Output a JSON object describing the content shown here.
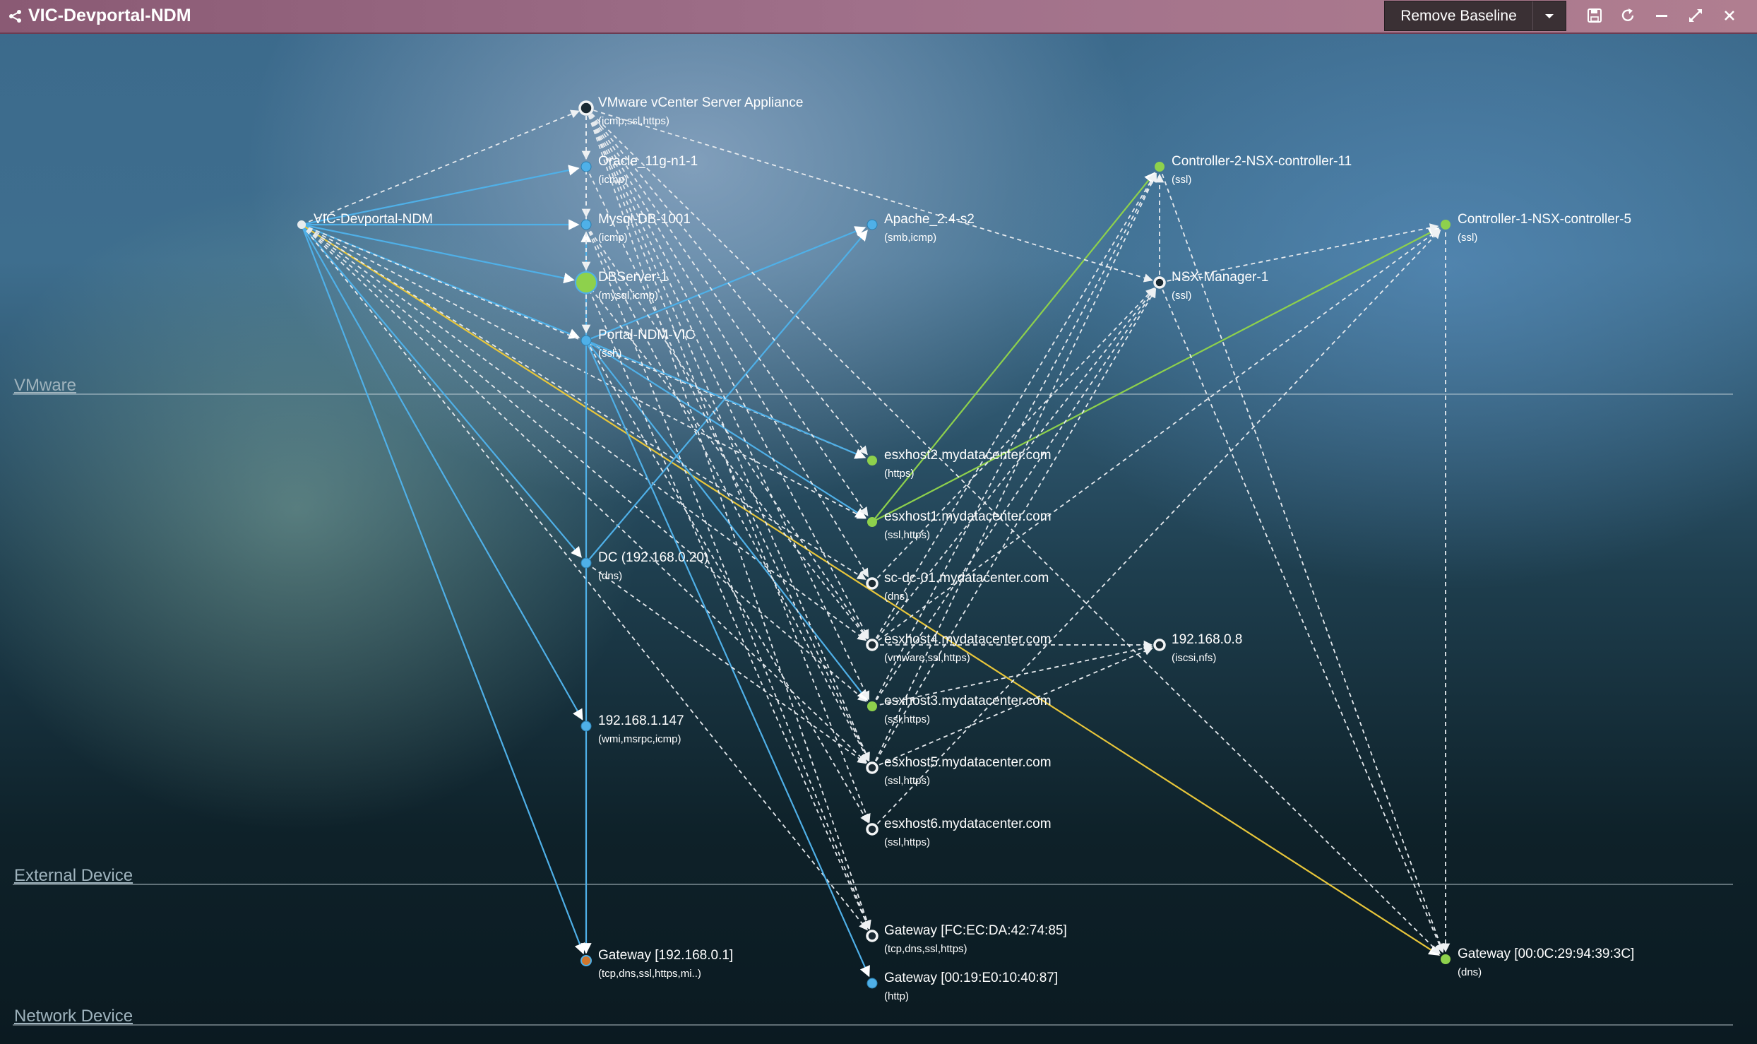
{
  "window": {
    "title": "VIC-Devportal-NDM",
    "remove_baseline_label": "Remove Baseline",
    "toolbar_icons": [
      "dropdown-caret-icon",
      "save-icon",
      "refresh-icon",
      "minimize-icon",
      "expand-icon",
      "close-icon"
    ]
  },
  "bands": [
    {
      "id": "vmware",
      "label": "VMware"
    },
    {
      "id": "external",
      "label": "External Device"
    },
    {
      "id": "network",
      "label": "Network Device"
    }
  ],
  "colors": {
    "blue_link": "#4fb0e8",
    "green_link": "#8ed14c",
    "yellow_link": "#e8c63a",
    "dashed_link": "#e6eaee",
    "green_node": "#8ed14c",
    "blue_node": "#4fb0e8",
    "orange_node": "#d0762c"
  },
  "nodes": [
    {
      "id": "vic",
      "label": "VIC-Devportal-NDM",
      "sub": "",
      "style": "white-dot"
    },
    {
      "id": "vcenter",
      "label": "VMware vCenter Server Appliance",
      "sub": "(icmp,ssl,https)",
      "style": "ring"
    },
    {
      "id": "oracle",
      "label": "Oracle_11g-n1-1",
      "sub": "(icmp)",
      "style": "blue"
    },
    {
      "id": "mysql",
      "label": "Mysql-DB-1001",
      "sub": "(icmp)",
      "style": "blue"
    },
    {
      "id": "dbserver",
      "label": "DBServer-1",
      "sub": "(mysql,icmp)",
      "style": "green-big"
    },
    {
      "id": "portal",
      "label": "Portal-NDM-VIC",
      "sub": "(ssh)",
      "style": "blue"
    },
    {
      "id": "apache",
      "label": "Apache_2.4-s2",
      "sub": "(smb,icmp)",
      "style": "blue"
    },
    {
      "id": "ctrl2",
      "label": "Controller-2-NSX-controller-11",
      "sub": "(ssl)",
      "style": "green"
    },
    {
      "id": "ctrl1",
      "label": "Controller-1-NSX-controller-5",
      "sub": "(ssl)",
      "style": "green"
    },
    {
      "id": "nsxmgr",
      "label": "NSX-Manager-1",
      "sub": "(ssl)",
      "style": "ring"
    },
    {
      "id": "esx2",
      "label": "esxhost2.mydatacenter.com",
      "sub": "(https)",
      "style": "green"
    },
    {
      "id": "esx1",
      "label": "esxhost1.mydatacenter.com",
      "sub": "(ssl,https)",
      "style": "green"
    },
    {
      "id": "scdc",
      "label": "sc-dc-01.mydatacenter.com",
      "sub": "(dns)",
      "style": "ring"
    },
    {
      "id": "esx4",
      "label": "esxhost4.mydatacenter.com",
      "sub": "(vmware,ssl,https)",
      "style": "ring"
    },
    {
      "id": "ip08",
      "label": "192.168.0.8",
      "sub": "(iscsi,nfs)",
      "style": "ring"
    },
    {
      "id": "esx3",
      "label": "esxhost3.mydatacenter.com",
      "sub": "(ssl,https)",
      "style": "green"
    },
    {
      "id": "esx5",
      "label": "esxhost5.mydatacenter.com",
      "sub": "(ssl,https)",
      "style": "ring"
    },
    {
      "id": "esx6",
      "label": "esxhost6.mydatacenter.com",
      "sub": "(ssl,https)",
      "style": "ring"
    },
    {
      "id": "dc",
      "label": "DC (192.168.0.20)",
      "sub": "(dns)",
      "style": "blue"
    },
    {
      "id": "ip147",
      "label": "192.168.1.147",
      "sub": "(wmi,msrpc,icmp)",
      "style": "blue"
    },
    {
      "id": "gw01",
      "label": "Gateway [192.168.0.1]",
      "sub": "(tcp,dns,ssl,https,mi..)",
      "style": "orange"
    },
    {
      "id": "gwfc",
      "label": "Gateway [FC:EC:DA:42:74:85]",
      "sub": "(tcp,dns,ssl,https)",
      "style": "ring"
    },
    {
      "id": "gw019",
      "label": "Gateway [00:19:E0:10:40:87]",
      "sub": "(http)",
      "style": "blue"
    },
    {
      "id": "gw00c",
      "label": "Gateway [00:0C:29:94:39:3C]",
      "sub": "(dns)",
      "style": "green"
    }
  ],
  "links": [
    {
      "from": "vic",
      "to": "oracle",
      "type": "blue"
    },
    {
      "from": "vic",
      "to": "mysql",
      "type": "blue"
    },
    {
      "from": "vic",
      "to": "dbserver",
      "type": "blue"
    },
    {
      "from": "vic",
      "to": "portal",
      "type": "blue"
    },
    {
      "from": "vic",
      "to": "dc",
      "type": "blue"
    },
    {
      "from": "vic",
      "to": "ip147",
      "type": "blue"
    },
    {
      "from": "vic",
      "to": "gw01",
      "type": "blue"
    },
    {
      "from": "vic",
      "to": "gw00c",
      "type": "yellow"
    },
    {
      "from": "vic",
      "to": "vcenter",
      "type": "dashed"
    },
    {
      "from": "vic",
      "to": "esx2",
      "type": "dashed"
    },
    {
      "from": "vic",
      "to": "esx1",
      "type": "dashed"
    },
    {
      "from": "vic",
      "to": "scdc",
      "type": "dashed"
    },
    {
      "from": "vic",
      "to": "esx4",
      "type": "dashed"
    },
    {
      "from": "vic",
      "to": "esx3",
      "type": "dashed"
    },
    {
      "from": "vic",
      "to": "esx5",
      "type": "dashed"
    },
    {
      "from": "vic",
      "to": "gwfc",
      "type": "dashed"
    },
    {
      "from": "portal",
      "to": "esx2",
      "type": "blue"
    },
    {
      "from": "portal",
      "to": "esx1",
      "type": "blue"
    },
    {
      "from": "portal",
      "to": "apache",
      "type": "blue"
    },
    {
      "from": "portal",
      "to": "esx3",
      "type": "blue"
    },
    {
      "from": "dc",
      "to": "apache",
      "type": "blue"
    },
    {
      "from": "portal",
      "to": "gw019",
      "type": "blue"
    },
    {
      "from": "portal",
      "to": "mysql",
      "type": "blue"
    },
    {
      "from": "portal",
      "to": "gw01",
      "type": "blue"
    },
    {
      "from": "esx1",
      "to": "ctrl2",
      "type": "green"
    },
    {
      "from": "esx1",
      "to": "ctrl1",
      "type": "green"
    },
    {
      "from": "vcenter",
      "to": "nsxmgr",
      "type": "dashed"
    },
    {
      "from": "vcenter",
      "to": "esx2",
      "type": "dashed"
    },
    {
      "from": "vcenter",
      "to": "esx1",
      "type": "dashed"
    },
    {
      "from": "vcenter",
      "to": "scdc",
      "type": "dashed"
    },
    {
      "from": "vcenter",
      "to": "esx4",
      "type": "dashed"
    },
    {
      "from": "vcenter",
      "to": "esx3",
      "type": "dashed"
    },
    {
      "from": "vcenter",
      "to": "esx5",
      "type": "dashed"
    },
    {
      "from": "vcenter",
      "to": "esx6",
      "type": "dashed"
    },
    {
      "from": "vcenter",
      "to": "gwfc",
      "type": "dashed"
    },
    {
      "from": "vcenter",
      "to": "gw00c",
      "type": "dashed"
    },
    {
      "from": "vcenter",
      "to": "oracle",
      "type": "dashed"
    },
    {
      "from": "vcenter",
      "to": "mysql",
      "type": "dashed"
    },
    {
      "from": "vcenter",
      "to": "dbserver",
      "type": "dashed"
    },
    {
      "from": "vcenter",
      "to": "portal",
      "type": "dashed"
    },
    {
      "from": "nsxmgr",
      "to": "ctrl2",
      "type": "dashed"
    },
    {
      "from": "nsxmgr",
      "to": "ctrl1",
      "type": "dashed"
    },
    {
      "from": "esx4",
      "to": "ctrl2",
      "type": "dashed"
    },
    {
      "from": "esx4",
      "to": "nsxmgr",
      "type": "dashed"
    },
    {
      "from": "esx4",
      "to": "ip08",
      "type": "dashed"
    },
    {
      "from": "esx3",
      "to": "ip08",
      "type": "dashed"
    },
    {
      "from": "esx5",
      "to": "ip08",
      "type": "dashed"
    },
    {
      "from": "esx5",
      "to": "ctrl2",
      "type": "dashed"
    },
    {
      "from": "esx5",
      "to": "nsxmgr",
      "type": "dashed"
    },
    {
      "from": "esx3",
      "to": "ctrl2",
      "type": "dashed"
    },
    {
      "from": "esx3",
      "to": "nsxmgr",
      "type": "dashed"
    },
    {
      "from": "esx6",
      "to": "ctrl1",
      "type": "dashed"
    },
    {
      "from": "esx4",
      "to": "ctrl1",
      "type": "dashed"
    },
    {
      "from": "ctrl1",
      "to": "gw00c",
      "type": "dashed"
    },
    {
      "from": "ctrl2",
      "to": "gw00c",
      "type": "dashed"
    },
    {
      "from": "nsxmgr",
      "to": "gw00c",
      "type": "dashed"
    },
    {
      "from": "scdc",
      "to": "nsxmgr",
      "type": "dashed"
    },
    {
      "from": "mysql",
      "to": "esx4",
      "type": "dashed"
    },
    {
      "from": "mysql",
      "to": "esx5",
      "type": "dashed"
    },
    {
      "from": "oracle",
      "to": "esx5",
      "type": "dashed"
    },
    {
      "from": "dbserver",
      "to": "esx4",
      "type": "dashed"
    },
    {
      "from": "dbserver",
      "to": "gwfc",
      "type": "dashed"
    },
    {
      "from": "dc",
      "to": "esx5",
      "type": "dashed"
    },
    {
      "from": "mysql",
      "to": "gwfc",
      "type": "dashed"
    },
    {
      "from": "portal",
      "to": "esx6",
      "type": "dashed"
    }
  ]
}
